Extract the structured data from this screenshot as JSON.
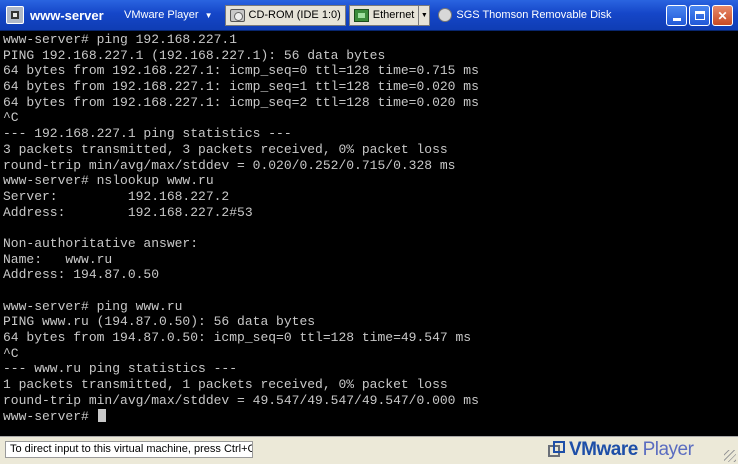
{
  "window": {
    "title": "www-server",
    "menu_label": "VMware Player",
    "devices": [
      {
        "label": "CD-ROM (IDE 1:0)",
        "icon": "cd-rom-icon"
      },
      {
        "label": "Ethernet",
        "icon": "network-adapter-icon"
      },
      {
        "label": "SGS Thomson Removable Disk",
        "icon": "usb-device-icon"
      }
    ]
  },
  "console": {
    "lines": [
      "www-server# ping 192.168.227.1",
      "PING 192.168.227.1 (192.168.227.1): 56 data bytes",
      "64 bytes from 192.168.227.1: icmp_seq=0 ttl=128 time=0.715 ms",
      "64 bytes from 192.168.227.1: icmp_seq=1 ttl=128 time=0.020 ms",
      "64 bytes from 192.168.227.1: icmp_seq=2 ttl=128 time=0.020 ms",
      "^C",
      "--- 192.168.227.1 ping statistics ---",
      "3 packets transmitted, 3 packets received, 0% packet loss",
      "round-trip min/avg/max/stddev = 0.020/0.252/0.715/0.328 ms",
      "www-server# nslookup www.ru",
      "Server:         192.168.227.2",
      "Address:        192.168.227.2#53",
      "",
      "Non-authoritative answer:",
      "Name:   www.ru",
      "Address: 194.87.0.50",
      "",
      "www-server# ping www.ru",
      "PING www.ru (194.87.0.50): 56 data bytes",
      "64 bytes from 194.87.0.50: icmp_seq=0 ttl=128 time=49.547 ms",
      "^C",
      "--- www.ru ping statistics ---",
      "1 packets transmitted, 1 packets received, 0% packet loss",
      "round-trip min/avg/max/stddev = 49.547/49.547/49.547/0.000 ms"
    ],
    "prompt": "www-server# "
  },
  "statusbar": {
    "hint": "To direct input to this virtual machine, press Ctrl+G.",
    "brand_strong": "VMware",
    "brand_light": " Player"
  },
  "colors": {
    "titlebar": "#1546c8",
    "console_bg": "#000000",
    "console_fg": "#c8c8c8",
    "statusbar": "#ece9d8"
  }
}
